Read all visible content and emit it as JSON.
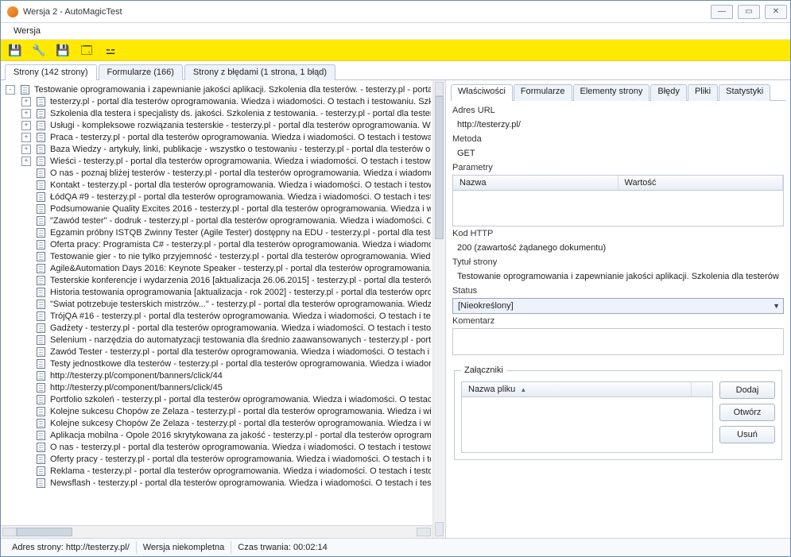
{
  "window": {
    "title": "Wersja 2 - AutoMagicTest"
  },
  "menu": {
    "wersja": "Wersja"
  },
  "toolbar": {
    "icons": [
      {
        "name": "save-icon",
        "glyph": "💾"
      },
      {
        "name": "wrench-icon",
        "glyph": "🔧"
      },
      {
        "name": "save-all-icon",
        "glyph": "💾"
      },
      {
        "name": "id-card-icon",
        "glyph": "🗔"
      },
      {
        "name": "sitemap-icon",
        "glyph": "⚍"
      }
    ]
  },
  "main_tabs": {
    "strony": "Strony (142 strony)",
    "formularze": "Formularze (166)",
    "bledy": "Strony z błędami (1 strona, 1 błąd)"
  },
  "tree": {
    "root_expanded": "-",
    "items": [
      {
        "d": 0,
        "exp": "-",
        "label": "Testowanie oprogramowania i zapewnianie jakości aplikacji. Szkolenia dla testerów. - testerzy.pl - portal "
      },
      {
        "d": 1,
        "exp": "+",
        "label": "testerzy.pl - portal dla testerów oprogramowania. Wiedza i wiadomości. O testach i testowaniu. Szkol"
      },
      {
        "d": 1,
        "exp": "+",
        "label": "Szkolenia dla testera i specjalisty ds. jakości. Szkolenia z testowania. - testerzy.pl - portal dla testerów"
      },
      {
        "d": 1,
        "exp": "+",
        "label": "Usługi - kompleksowe rozwiązania testerskie - testerzy.pl - portal dla testerów oprogramowania. Wie"
      },
      {
        "d": 1,
        "exp": "+",
        "label": "Praca - testerzy.pl - portal dla testerów oprogramowania. Wiedza i wiadomości. O testach i testowan"
      },
      {
        "d": 1,
        "exp": "+",
        "label": "Baza Wiedzy - artykuły, linki, publikacje - wszystko o testowaniu - testerzy.pl - portal dla testerów op"
      },
      {
        "d": 1,
        "exp": "+",
        "label": "Wieści - testerzy.pl - portal dla testerów oprogramowania. Wiedza i wiadomości. O testach i testowan"
      },
      {
        "d": 1,
        "exp": "",
        "label": "O nas - poznaj bliżej testerów - testerzy.pl - portal dla testerów oprogramowania. Wiedza i wiadomośc"
      },
      {
        "d": 1,
        "exp": "",
        "label": "Kontakt - testerzy.pl - portal dla testerów oprogramowania. Wiedza i wiadomości. O testach i testowa"
      },
      {
        "d": 1,
        "exp": "",
        "label": "ŁódQA #9 - testerzy.pl - portal dla testerów oprogramowania. Wiedza i wiadomości. O testach i testo"
      },
      {
        "d": 1,
        "exp": "",
        "label": "Podsumowanie Quality Excites 2016 - testerzy.pl - portal dla testerów oprogramowania. Wiedza i wia"
      },
      {
        "d": 1,
        "exp": "",
        "label": "\"Zawód tester\" - dodruk - testerzy.pl - portal dla testerów oprogramowania. Wiedza i wiadomości. O "
      },
      {
        "d": 1,
        "exp": "",
        "label": "Egzamin próbny ISTQB Zwinny Tester (Agile Tester) dostępny na EDU - testerzy.pl - portal dla tester"
      },
      {
        "d": 1,
        "exp": "",
        "label": "Oferta pracy: Programista C# - testerzy.pl - portal dla testerów oprogramowania. Wiedza i wiadomośc"
      },
      {
        "d": 1,
        "exp": "",
        "label": "Testowanie gier - to nie tylko przyjemność - testerzy.pl - portal dla testerów oprogramowania. Wiedza"
      },
      {
        "d": 1,
        "exp": "",
        "label": "Agile&Automation Days 2016: Keynote Speaker - testerzy.pl - portal dla testerów oprogramowania. W"
      },
      {
        "d": 1,
        "exp": "",
        "label": "Testerskie konferencje i wydarzenia 2016 [aktualizacja 26.06.2015] - testerzy.pl - portal dla testerów"
      },
      {
        "d": 1,
        "exp": "",
        "label": "Historia testowania oprogramowania [aktualizacja - rok 2002] - testerzy.pl - portal dla testerów oprog"
      },
      {
        "d": 1,
        "exp": "",
        "label": "\"Świat potrzebuje testerskich mistrzów...\" - testerzy.pl - portal dla testerów oprogramowania. Wiedza"
      },
      {
        "d": 1,
        "exp": "",
        "label": "TrójQA #16 - testerzy.pl - portal dla testerów oprogramowania. Wiedza i wiadomości. O testach i test"
      },
      {
        "d": 1,
        "exp": "",
        "label": "Gadżety - testerzy.pl - portal dla testerów oprogramowania. Wiedza i wiadomości. O testach i testow"
      },
      {
        "d": 1,
        "exp": "",
        "label": "Selenium - narzędzia do automatyzacji testowania dla średnio zaawansowanych - testerzy.pl - portal "
      },
      {
        "d": 1,
        "exp": "",
        "label": "Zawód Tester - testerzy.pl - portal dla testerów oprogramowania. Wiedza i wiadomości. O testach i t"
      },
      {
        "d": 1,
        "exp": "",
        "label": "Testy jednostkowe dla testerów - testerzy.pl - portal dla testerów oprogramowania. Wiedza i wiadom"
      },
      {
        "d": 1,
        "exp": "",
        "label": "http://testerzy.pl/component/banners/click/44"
      },
      {
        "d": 1,
        "exp": "",
        "label": "http://testerzy.pl/component/banners/click/45"
      },
      {
        "d": 1,
        "exp": "",
        "label": "Portfolio szkoleń - testerzy.pl - portal dla testerów oprogramowania. Wiedza i wiadomości. O testach "
      },
      {
        "d": 1,
        "exp": "",
        "label": "Kolejne sukcesu Chopów ze Zelaza - testerzy.pl - portal dla testerów oprogramowania. Wiedza i wia"
      },
      {
        "d": 1,
        "exp": "",
        "label": "Kolejne sukcesy Chopów Ze Zelaza - testerzy.pl - portal dla testerów oprogramowania. Wiedza i wia"
      },
      {
        "d": 1,
        "exp": "",
        "label": "Aplikacja mobilna - Opole 2016 skrytykowana za jakość - testerzy.pl - portal dla testerów oprogramow"
      },
      {
        "d": 1,
        "exp": "",
        "label": "O nas - testerzy.pl - portal dla testerów oprogramowania. Wiedza i wiadomości. O testach i testowan"
      },
      {
        "d": 1,
        "exp": "",
        "label": "Oferty pracy - testerzy.pl - portal dla testerów oprogramowania. Wiedza i wiadomości. O testach i tes"
      },
      {
        "d": 1,
        "exp": "",
        "label": "Reklama - testerzy.pl - portal dla testerów oprogramowania. Wiedza i wiadomości. O testach i testow"
      },
      {
        "d": 1,
        "exp": "",
        "label": "Newsflash - testerzy.pl - portal dla testerów oprogramowania. Wiedza i wiadomości. O testach i testo"
      }
    ]
  },
  "right_tabs": {
    "wlasciwosci": "Właściwości",
    "formularze": "Formularze",
    "elementy": "Elementy strony",
    "bledy": "Błędy",
    "pliki": "Pliki",
    "statystyki": "Statystyki"
  },
  "props": {
    "adres_url_label": "Adres URL",
    "adres_url_value": "http://testerzy.pl/",
    "metoda_label": "Metoda",
    "metoda_value": "GET",
    "parametry_label": "Parametry",
    "parametry_head_nazwa": "Nazwa",
    "parametry_head_wartosc": "Wartość",
    "kod_http_label": "Kod HTTP",
    "kod_http_value": "200 (zawartość żądanego dokumentu)",
    "tytul_label": "Tytuł strony",
    "tytul_value": "Testowanie oprogramowania i zapewnianie jakości aplikacji. Szkolenia dla testerów",
    "status_label": "Status",
    "status_value": "[Nieokreślony]",
    "komentarz_label": "Komentarz",
    "zalaczniki_label": "Załączniki",
    "zalaczniki_head": "Nazwa pliku",
    "btn_dodaj": "Dodaj",
    "btn_otworz": "Otwórz",
    "btn_usun": "Usuń"
  },
  "status": {
    "adres_label": "Adres strony: ",
    "adres_value": "http://testerzy.pl/",
    "wersja": "Wersja niekompletna",
    "czas": "Czas trwania: 00:02:14"
  }
}
